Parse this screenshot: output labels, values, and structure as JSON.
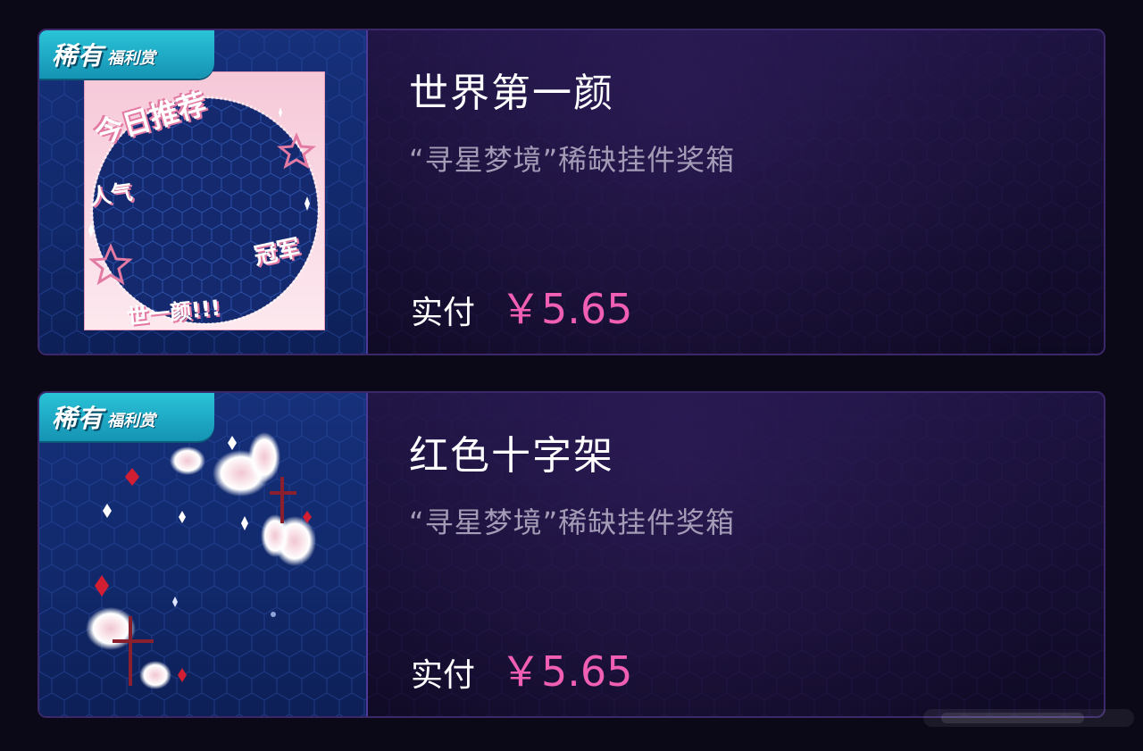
{
  "items": [
    {
      "badge_main": "稀有",
      "badge_sub": "福利赏",
      "title": "世界第一颜",
      "subtitle": "“寻星梦境”稀缺挂件奖箱",
      "price_label": "实付",
      "price": "￥5.65",
      "thumb_icon": "avatar-frame-icon",
      "frame_text": [
        "今日推荐",
        "人气",
        "冠军",
        "世一颜!!!"
      ]
    },
    {
      "badge_main": "稀有",
      "badge_sub": "福利赏",
      "title": "红色十字架",
      "subtitle": "“寻星梦境”稀缺挂件奖箱",
      "price_label": "实付",
      "price": "￥5.65",
      "thumb_icon": "butterfly-cross-pendant-icon"
    }
  ],
  "colors": {
    "price": "#f05fb4",
    "badge": "#1fb0c8",
    "card_bg": "#1a1138",
    "thumb_bg": "#14296e"
  }
}
